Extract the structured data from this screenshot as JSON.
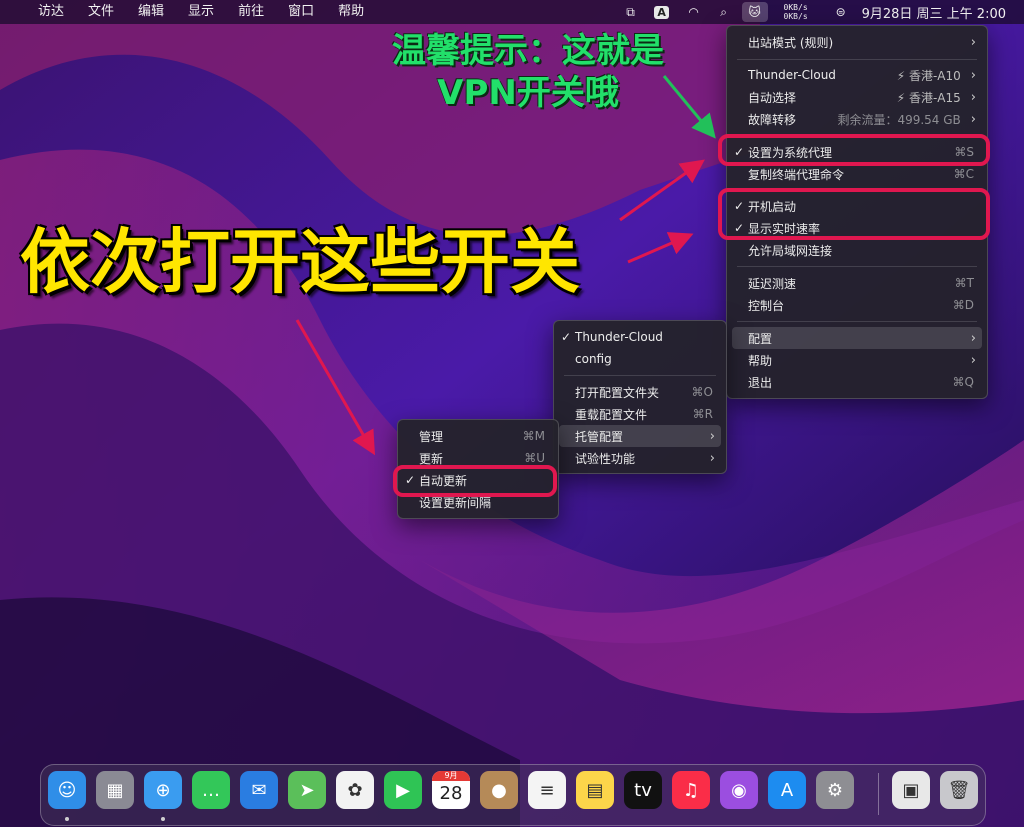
{
  "menubar": {
    "items": [
      "访达",
      "文件",
      "编辑",
      "显示",
      "前往",
      "窗口",
      "帮助"
    ],
    "speed_up": "0KB/s",
    "speed_down": "0KB/s",
    "clock": "9月28日 周三 上午 2:00"
  },
  "main_menu": {
    "proxy_mode": "出站模式 (规则)",
    "group1": {
      "name": "Thunder-Cloud",
      "value": "⚡ 香港-A10"
    },
    "group2": {
      "name": "自动选择",
      "value": "⚡ 香港-A15"
    },
    "group3": {
      "name": "故障转移",
      "value": "剩余流量：499.54 GB"
    },
    "set_system_proxy": {
      "label": "设置为系统代理",
      "shortcut": "⌘S"
    },
    "copy_terminal": {
      "label": "复制终端代理命令",
      "shortcut": "⌘C"
    },
    "start_at_login": {
      "label": "开机启动"
    },
    "show_speed": {
      "label": "显示实时速率"
    },
    "allow_lan": {
      "label": "允许局域网连接"
    },
    "latency_test": {
      "label": "延迟测速",
      "shortcut": "⌘T"
    },
    "dashboard": {
      "label": "控制台",
      "shortcut": "⌘D"
    },
    "config": {
      "label": "配置"
    },
    "help": {
      "label": "帮助"
    },
    "quit": {
      "label": "退出",
      "shortcut": "⌘Q"
    }
  },
  "config_menu": {
    "profile1": "Thunder-Cloud",
    "profile2": "config",
    "open_folder": {
      "label": "打开配置文件夹",
      "shortcut": "⌘O"
    },
    "reload": {
      "label": "重载配置文件",
      "shortcut": "⌘R"
    },
    "hosted": {
      "label": "托管配置"
    },
    "experimental": {
      "label": "试验性功能"
    }
  },
  "hosted_menu": {
    "manage": {
      "label": "管理",
      "shortcut": "⌘M"
    },
    "update": {
      "label": "更新",
      "shortcut": "⌘U"
    },
    "auto_update": {
      "label": "自动更新"
    },
    "set_interval": {
      "label": "设置更新间隔"
    }
  },
  "annotations": {
    "tip_line1": "温馨提示：这就是",
    "tip_line2": "VPN开关哦",
    "instruction": "依次打开这些开关",
    "arrow_color": "#e0174f",
    "tip_color": "#22e06a",
    "instruction_color": "#ffe600"
  },
  "dock": {
    "apps": [
      {
        "name": "finder-icon",
        "glyph": "☺",
        "color": "#2f8ee8"
      },
      {
        "name": "launchpad-icon",
        "glyph": "▦",
        "color": "#8a8a94"
      },
      {
        "name": "safari-icon",
        "glyph": "⊕",
        "color": "#3a9cf0"
      },
      {
        "name": "messages-icon",
        "glyph": "…",
        "color": "#33c759"
      },
      {
        "name": "mail-icon",
        "glyph": "✉",
        "color": "#2a7de1"
      },
      {
        "name": "maps-icon",
        "glyph": "➤",
        "color": "#5bbf5a"
      },
      {
        "name": "photos-icon",
        "glyph": "✿",
        "color": "#f2f2f2"
      },
      {
        "name": "facetime-icon",
        "glyph": "▶",
        "color": "#2fc455"
      },
      {
        "name": "calendar-icon",
        "glyph": "",
        "color": "#ffffff"
      },
      {
        "name": "contacts-icon",
        "glyph": "●",
        "color": "#b58a58"
      },
      {
        "name": "reminders-icon",
        "glyph": "≡",
        "color": "#f4f4f4"
      },
      {
        "name": "notes-icon",
        "glyph": "▤",
        "color": "#fcd54a"
      },
      {
        "name": "appletv-icon",
        "glyph": "tv",
        "color": "#111111"
      },
      {
        "name": "music-icon",
        "glyph": "♫",
        "color": "#fa2d48"
      },
      {
        "name": "podcasts-icon",
        "glyph": "◉",
        "color": "#9b4ee0"
      },
      {
        "name": "appstore-icon",
        "glyph": "A",
        "color": "#1d8cf0"
      },
      {
        "name": "settings-icon",
        "glyph": "⚙",
        "color": "#8e8e93"
      },
      {
        "name": "preview-icon",
        "glyph": "▣",
        "color": "#e8e8e8"
      },
      {
        "name": "trash-icon",
        "glyph": "🗑",
        "color": "#c8c8cc"
      }
    ],
    "calendar_month": "9月",
    "calendar_day": "28"
  }
}
